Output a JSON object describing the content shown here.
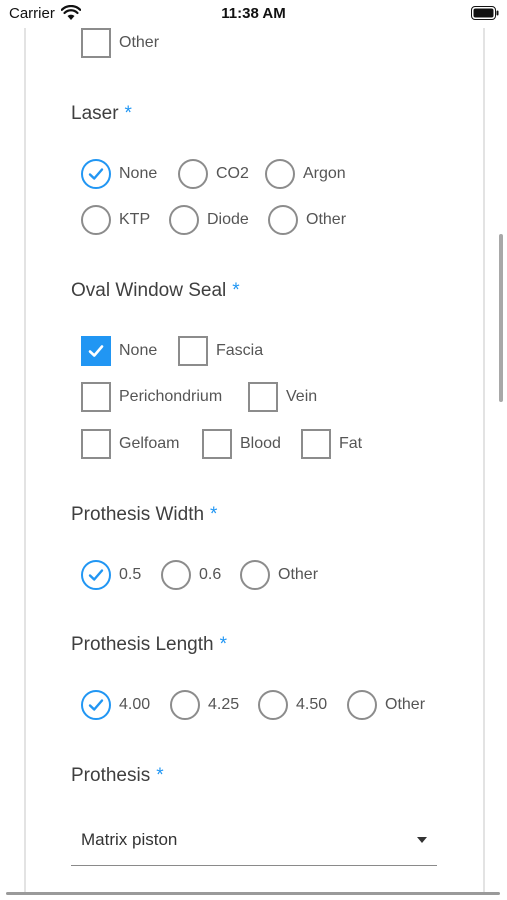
{
  "status": {
    "carrier": "Carrier",
    "time": "11:38 AM"
  },
  "top": {
    "other_label": "Other"
  },
  "laser": {
    "title": "Laser",
    "required": "*",
    "options": [
      "None",
      "CO2",
      "Argon",
      "KTP",
      "Diode",
      "Other"
    ],
    "selected": "None"
  },
  "oval_window_seal": {
    "title": "Oval Window Seal",
    "required": "*",
    "options": [
      "None",
      "Fascia",
      "Perichondrium",
      "Vein",
      "Gelfoam",
      "Blood",
      "Fat"
    ],
    "checked": [
      "None"
    ]
  },
  "prothesis_width": {
    "title": "Prothesis Width",
    "required": "*",
    "options": [
      "0.5",
      "0.6",
      "Other"
    ],
    "selected": "0.5"
  },
  "prothesis_length": {
    "title": "Prothesis Length",
    "required": "*",
    "options": [
      "4.00",
      "4.25",
      "4.50",
      "Other"
    ],
    "selected": "4.00"
  },
  "prothesis": {
    "title": "Prothesis",
    "required": "*",
    "value": "Matrix piston"
  },
  "colors": {
    "accent": "#2196f3",
    "control_border": "#8c8c8c"
  }
}
